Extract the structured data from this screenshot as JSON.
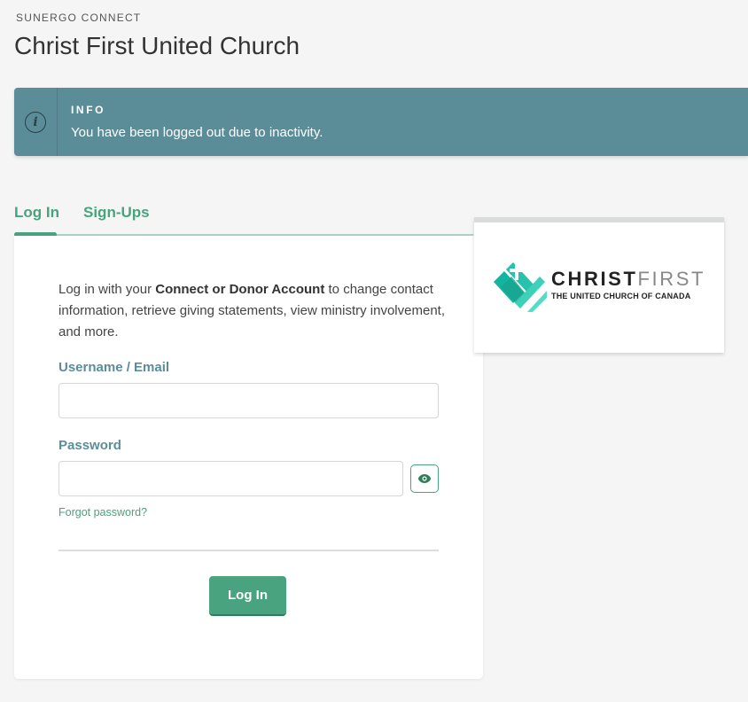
{
  "header": {
    "brand": "SUNERGO CONNECT",
    "title": "Christ First United Church"
  },
  "alert": {
    "icon": "info-icon",
    "title": "INFO",
    "message": "You have been logged out due to inactivity."
  },
  "tabs": [
    {
      "label": "Log In",
      "active": true
    },
    {
      "label": "Sign-Ups",
      "active": false
    }
  ],
  "login": {
    "intro_pre": "Log in with your ",
    "intro_bold": "Connect or Donor Account",
    "intro_post": " to change contact information, retrieve giving statements, view ministry involvement, and more.",
    "username_label": "Username / Email",
    "username_value": "",
    "password_label": "Password",
    "password_value": "",
    "toggle_icon": "eye-icon",
    "forgot_label": "Forgot password?",
    "submit_label": "Log In"
  },
  "logo": {
    "word1": "CHRIST",
    "word2": "FIRST",
    "subtitle": "THE UNITED CHURCH OF CANADA"
  },
  "colors": {
    "accent": "#48a37e",
    "alert_bg": "#5b8d99",
    "label": "#5b8d99",
    "background": "#f5f5f5"
  }
}
